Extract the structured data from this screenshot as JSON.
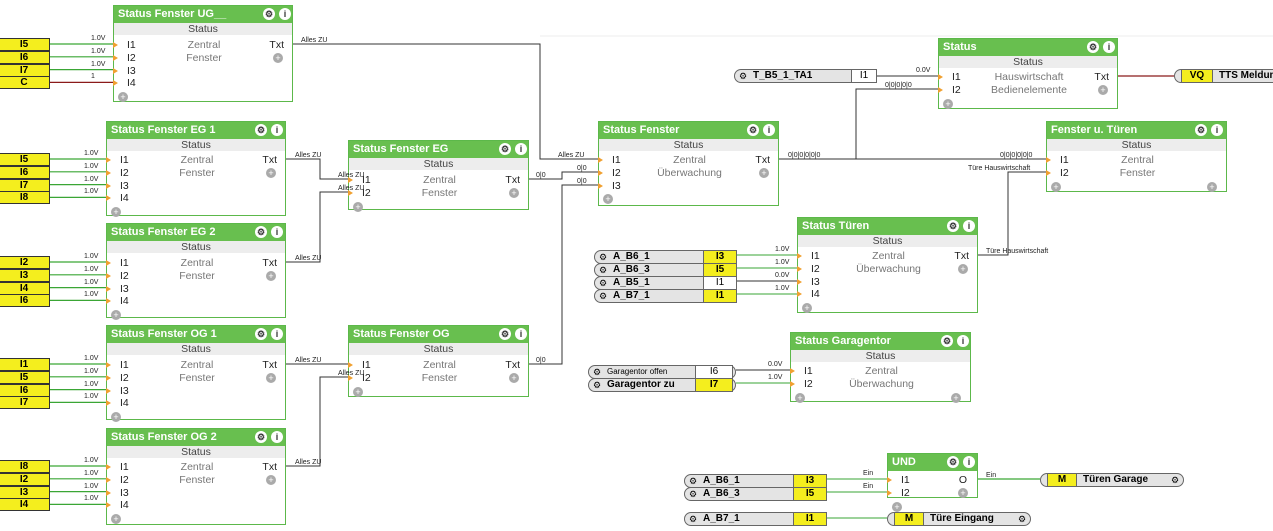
{
  "blocks": [
    {
      "key": "ug",
      "title": "Status Fenster UG__",
      "status": "Status",
      "inputs": [
        "I1",
        "I2",
        "I3",
        "I4"
      ],
      "d1": "Zentral",
      "d2": "Fenster",
      "out": "Txt"
    },
    {
      "key": "eg1",
      "title": "Status Fenster EG 1",
      "status": "Status",
      "inputs": [
        "I1",
        "I2",
        "I3",
        "I4"
      ],
      "d1": "Zentral",
      "d2": "Fenster",
      "out": "Txt"
    },
    {
      "key": "eg2",
      "title": "Status Fenster EG 2",
      "status": "Status",
      "inputs": [
        "I1",
        "I2",
        "I3",
        "I4"
      ],
      "d1": "Zentral",
      "d2": "Fenster",
      "out": "Txt"
    },
    {
      "key": "og1",
      "title": "Status Fenster OG 1",
      "status": "Status",
      "inputs": [
        "I1",
        "I2",
        "I3",
        "I4"
      ],
      "d1": "Zentral",
      "d2": "Fenster",
      "out": "Txt"
    },
    {
      "key": "og2",
      "title": "Status Fenster OG 2",
      "status": "Status",
      "inputs": [
        "I1",
        "I2",
        "I3",
        "I4"
      ],
      "d1": "Zentral",
      "d2": "Fenster",
      "out": "Txt"
    },
    {
      "key": "eg",
      "title": "Status Fenster EG",
      "status": "Status",
      "inputs": [
        "I1",
        "I2"
      ],
      "d1": "Zentral",
      "d2": "Fenster",
      "out": "Txt"
    },
    {
      "key": "og",
      "title": "Status Fenster OG",
      "status": "Status",
      "inputs": [
        "I1",
        "I2"
      ],
      "d1": "Zentral",
      "d2": "Fenster",
      "out": "Txt"
    },
    {
      "key": "sf",
      "title": "Status Fenster",
      "status": "Status",
      "inputs": [
        "I1",
        "I2",
        "I3"
      ],
      "d1": "Zentral",
      "d2": "Überwachung",
      "out": "Txt"
    },
    {
      "key": "st",
      "title": "Status",
      "status": "Status",
      "inputs": [
        "I1",
        "I2"
      ],
      "d1": "Hauswirtschaft",
      "d2": "Bedienelemente",
      "out": "Txt"
    },
    {
      "key": "fut",
      "title": "Fenster u. Türen",
      "status": "Status",
      "inputs": [
        "I1",
        "I2"
      ],
      "d1": "Zentral",
      "d2": "Fenster",
      "out": ""
    },
    {
      "key": "tue",
      "title": "Status Türen",
      "status": "Status",
      "inputs": [
        "I1",
        "I2",
        "I3",
        "I4"
      ],
      "d1": "Zentral",
      "d2": "Überwachung",
      "out": "Txt"
    },
    {
      "key": "gar",
      "title": "Status Garagentor",
      "status": "Status",
      "inputs": [
        "I1",
        "I2"
      ],
      "d1": "Zentral",
      "d2": "Überwachung",
      "out": ""
    },
    {
      "key": "und",
      "title": "UND",
      "status": "",
      "inputs": [
        "I1",
        "I2"
      ],
      "d1": "",
      "d2": "",
      "out": "O"
    }
  ],
  "left_inputs": [
    {
      "key": "ug",
      "labels": [
        "I5",
        "I6",
        "I7",
        "C"
      ],
      "values": [
        "1.0V",
        "1.0V",
        "1.0V",
        "1"
      ]
    },
    {
      "key": "eg1",
      "labels": [
        "I5",
        "I6",
        "I7",
        "I8"
      ],
      "values": [
        "1.0V",
        "1.0V",
        "1.0V",
        "1.0V"
      ]
    },
    {
      "key": "eg2",
      "labels": [
        "I2",
        "I3",
        "I4",
        "I6"
      ],
      "values": [
        "1.0V",
        "1.0V",
        "1.0V",
        "1.0V"
      ]
    },
    {
      "key": "og1",
      "labels": [
        "I1",
        "I5",
        "I6",
        "I7"
      ],
      "values": [
        "1.0V",
        "1.0V",
        "1.0V",
        "1.0V"
      ]
    },
    {
      "key": "og2",
      "labels": [
        "I8",
        "I2",
        "I3",
        "I4"
      ],
      "values": [
        "1.0V",
        "1.0V",
        "1.0V",
        "1.0V"
      ]
    }
  ],
  "sources": [
    {
      "name": "T_B5_1_TA1",
      "port": "I1",
      "yellow": false,
      "value": "0.0V",
      "target": "st"
    },
    {
      "name": "A_B6_1",
      "port": "I3",
      "yellow": true,
      "value": "1.0V",
      "target": "tue"
    },
    {
      "name": "A_B6_3",
      "port": "I5",
      "yellow": true,
      "value": "1.0V",
      "target": "tue"
    },
    {
      "name": "A_B5_1",
      "port": "I1",
      "yellow": false,
      "value": "0.0V",
      "target": "tue"
    },
    {
      "name": "A_B7_1",
      "port": "I1",
      "yellow": true,
      "value": "1.0V",
      "target": "tue"
    },
    {
      "name": "Garagentor offen",
      "port": "I6",
      "yellow": false,
      "value": "0.0V",
      "target": "gar"
    },
    {
      "name": "Garagentor zu",
      "port": "I7",
      "yellow": true,
      "value": "1.0V",
      "target": "gar"
    },
    {
      "name": "A_B6_1",
      "port": "I3",
      "yellow": true,
      "value": "Ein",
      "target": "und"
    },
    {
      "name": "A_B6_3",
      "port": "I5",
      "yellow": true,
      "value": "Ein",
      "target": "und"
    },
    {
      "name": "A_B7_1",
      "port": "I1",
      "yellow": true,
      "value": "",
      "target": "tuere-eingang"
    }
  ],
  "outputs": [
    {
      "port": "VQ",
      "name": "TTS Meldung"
    },
    {
      "port": "M",
      "name": "Türen Garage"
    },
    {
      "port": "M",
      "name": "Türe Eingang"
    }
  ],
  "wire_labels": {
    "alles_zu": "Alles ZU",
    "zero_zero": "0|0",
    "multi_zero": "0|0|0|0|0",
    "multi_zero_b": "0|0|0|0|0|0",
    "tuere_hw": "Türe Hauswirtschaft",
    "ein": "Ein"
  },
  "colors": {
    "header": "#68bf4f",
    "signal": "#f4ee1e",
    "wire": "#333333",
    "wire_green": "#3aa635",
    "wire_red": "#8b1a1a"
  }
}
